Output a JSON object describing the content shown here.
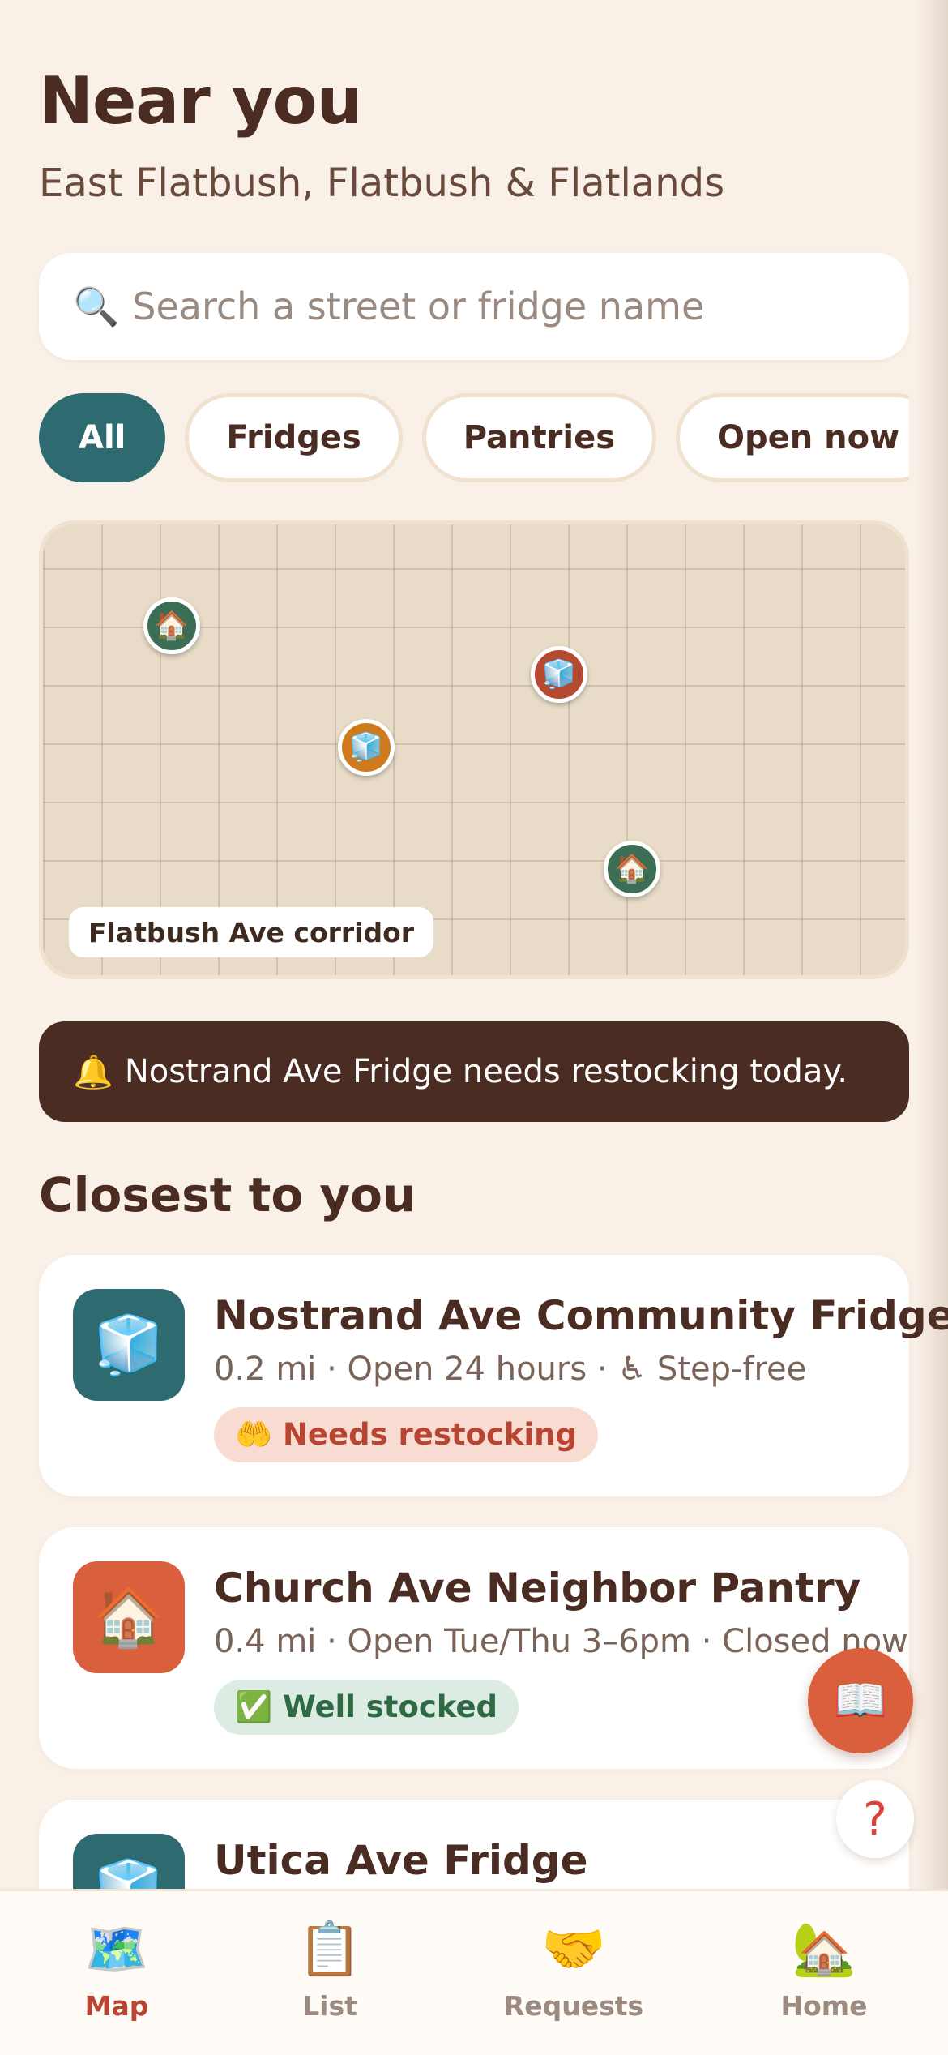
{
  "header": {
    "title": "Near you",
    "subtitle": "East Flatbush, Flatbush & Flatlands"
  },
  "search": {
    "icon": "magnifier-icon",
    "placeholder": "Search a street or fridge name",
    "value": ""
  },
  "filters": [
    {
      "label": "All",
      "active": true
    },
    {
      "label": "Fridges",
      "active": false
    },
    {
      "label": "Pantries",
      "active": false
    },
    {
      "label": "Open now",
      "active": false
    },
    {
      "label": "",
      "active": false
    }
  ],
  "map": {
    "label": "Flatbush Ave corridor",
    "pins": [
      {
        "type": "pantry",
        "glyph": "🏠",
        "color": "#3b6e55"
      },
      {
        "type": "fridge",
        "glyph": "🧊",
        "color": "#b54a30"
      },
      {
        "type": "fridge",
        "glyph": "🧊",
        "color": "#cf7a1c"
      },
      {
        "type": "pantry",
        "glyph": "🏠",
        "color": "#3b6e55"
      }
    ]
  },
  "alert": {
    "icon": "🔔",
    "text": "Nostrand Ave Fridge needs restocking today."
  },
  "section_title": "Closest to you",
  "cards": [
    {
      "name": "Nostrand Ave Community Fridge",
      "meta": "0.2 mi · Open 24 hours · ♿ Step-free",
      "icon": "🧊",
      "icon_bg": "#2d6b70",
      "badge": "🤲 Needs restocking",
      "badge_kind": "warn"
    },
    {
      "name": "Church Ave Neighbor Pantry",
      "meta": "0.4 mi · Open Tue/Thu 3–6pm · Closed now",
      "icon": "🏠",
      "icon_bg": "#d95f3d",
      "badge": "✅ Well stocked",
      "badge_kind": "ok"
    },
    {
      "name": "Utica Ave Fridge",
      "icon": "🧊",
      "icon_bg": "#2d6b70"
    }
  ],
  "fab": {
    "book_icon": "📖",
    "help_icon": "?"
  },
  "tabbar": [
    {
      "label": "Map",
      "icon": "🗺️",
      "active": true
    },
    {
      "label": "List",
      "icon": "📋",
      "active": false
    },
    {
      "label": "Requests",
      "icon": "🤝",
      "active": false
    },
    {
      "label": "Home",
      "icon": "🏡",
      "active": false
    }
  ],
  "colors": {
    "background": "#f9f0e7",
    "primary_text": "#4a2c22",
    "accent_teal": "#2d6b70",
    "accent_orange": "#d95f3d",
    "warn_text": "#b84532",
    "ok_text": "#2f6a45"
  }
}
